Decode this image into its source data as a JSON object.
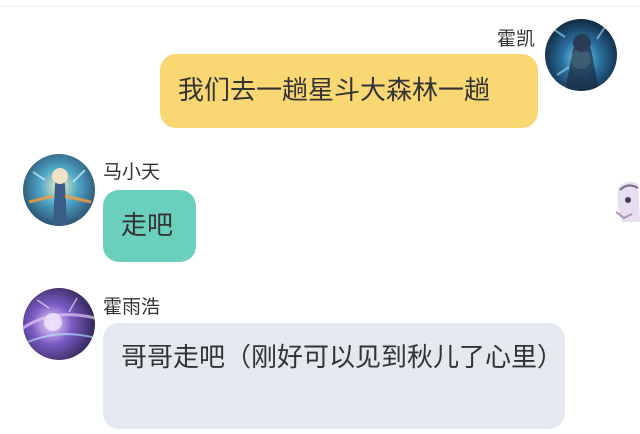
{
  "messages": [
    {
      "side": "right",
      "sender": "霍凯",
      "text": "我们去一趟星斗大森林一趟",
      "bubble_color": "#f9d874"
    },
    {
      "side": "left",
      "sender": "马小天",
      "text": "走吧",
      "bubble_color": "#6bcfbe"
    },
    {
      "side": "left",
      "sender": "霍雨浩",
      "text": "哥哥走吧（刚好可以见到秋儿了心里）",
      "bubble_color": "#e3e9ef"
    }
  ],
  "icons": {
    "avatar_1": "anime-character-avatar-icon",
    "avatar_2": "anime-character-avatar-icon",
    "avatar_3": "anime-character-avatar-icon",
    "edge_sticker": "anime-sticker-icon"
  }
}
